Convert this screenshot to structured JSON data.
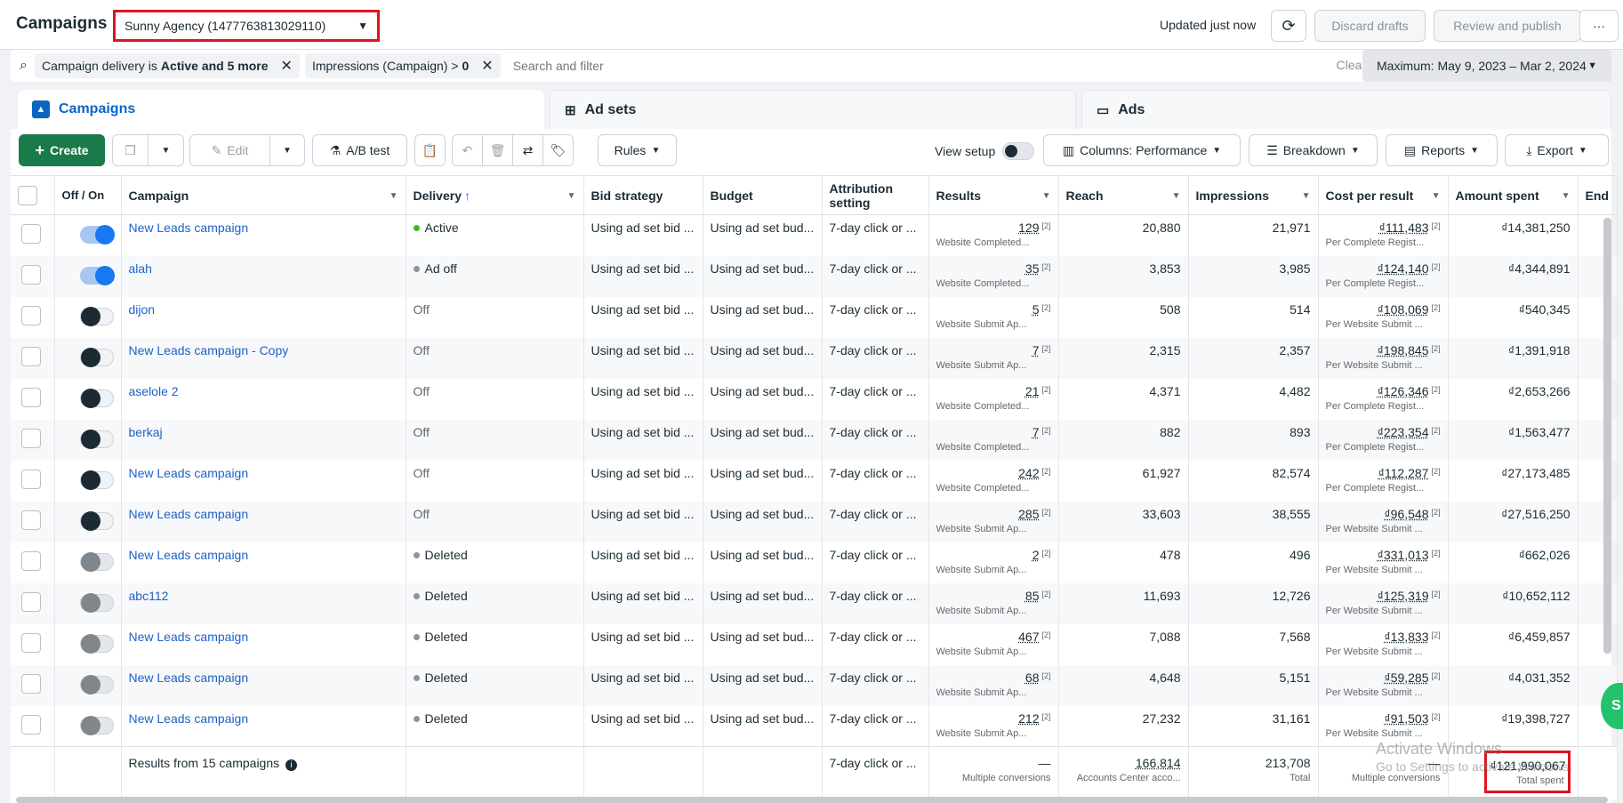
{
  "header": {
    "title": "Campaigns",
    "account_selector": "Sunny Agency (1477763813029110)",
    "updated": "Updated just now",
    "discard": "Discard drafts",
    "review": "Review and publish",
    "more": "···"
  },
  "filters": {
    "chip1_label": "Campaign delivery is",
    "chip1_value": "Active and 5 more",
    "chip2_label": "Impressions (Campaign) >",
    "chip2_value": "0",
    "search_placeholder": "Search and filter",
    "clear": "Clear",
    "date_range": "Maximum: May 9, 2023 – Mar 2, 2024"
  },
  "tabs": [
    "Campaigns",
    "Ad sets",
    "Ads"
  ],
  "toolbar": {
    "create": "Create",
    "edit": "Edit",
    "ab_test": "A/B test",
    "rules": "Rules",
    "view_setup": "View setup",
    "columns": "Columns: Performance",
    "breakdown": "Breakdown",
    "reports": "Reports",
    "export": "Export"
  },
  "columns": [
    "Off / On",
    "Campaign",
    "Delivery",
    "Bid strategy",
    "Budget",
    "Attribution setting",
    "Results",
    "Reach",
    "Impressions",
    "Cost per result",
    "Amount spent",
    "End"
  ],
  "rows": [
    {
      "toggle": "on",
      "name": "New Leads campaign",
      "delivery": "Active",
      "delivery_color": "#42b72a",
      "bid": "Using ad set bid ...",
      "budget": "Using ad set bud...",
      "attribution": "7-day click or ...",
      "results": "129",
      "results_sub": "Website Completed...",
      "reach": "20,880",
      "impressions": "21,971",
      "cpr": "₫111,483",
      "cpr_sub": "Per Complete Regist...",
      "spent": "₫14,381,250"
    },
    {
      "toggle": "on",
      "name": "alah",
      "delivery": "Ad off",
      "delivery_color": "#8d949e",
      "bid": "Using ad set bid ...",
      "budget": "Using ad set bud...",
      "attribution": "7-day click or ...",
      "results": "35",
      "results_sub": "Website Completed...",
      "reach": "3,853",
      "impressions": "3,985",
      "cpr": "₫124,140",
      "cpr_sub": "Per Complete Regist...",
      "spent": "₫4,344,891"
    },
    {
      "toggle": "off",
      "name": "dijon",
      "delivery": "Off",
      "delivery_color": "",
      "bid": "Using ad set bid ...",
      "budget": "Using ad set bud...",
      "attribution": "7-day click or ...",
      "results": "5",
      "results_sub": "Website Submit Ap...",
      "reach": "508",
      "impressions": "514",
      "cpr": "₫108,069",
      "cpr_sub": "Per Website Submit ...",
      "spent": "₫540,345"
    },
    {
      "toggle": "off",
      "name": "New Leads campaign - Copy",
      "delivery": "Off",
      "delivery_color": "",
      "bid": "Using ad set bid ...",
      "budget": "Using ad set bud...",
      "attribution": "7-day click or ...",
      "results": "7",
      "results_sub": "Website Submit Ap...",
      "reach": "2,315",
      "impressions": "2,357",
      "cpr": "₫198,845",
      "cpr_sub": "Per Website Submit ...",
      "spent": "₫1,391,918"
    },
    {
      "toggle": "off",
      "name": "aselole 2",
      "delivery": "Off",
      "delivery_color": "",
      "bid": "Using ad set bid ...",
      "budget": "Using ad set bud...",
      "attribution": "7-day click or ...",
      "results": "21",
      "results_sub": "Website Completed...",
      "reach": "4,371",
      "impressions": "4,482",
      "cpr": "₫126,346",
      "cpr_sub": "Per Complete Regist...",
      "spent": "₫2,653,266"
    },
    {
      "toggle": "off",
      "name": "berkaj",
      "delivery": "Off",
      "delivery_color": "",
      "bid": "Using ad set bid ...",
      "budget": "Using ad set bud...",
      "attribution": "7-day click or ...",
      "results": "7",
      "results_sub": "Website Completed...",
      "reach": "882",
      "impressions": "893",
      "cpr": "₫223,354",
      "cpr_sub": "Per Complete Regist...",
      "spent": "₫1,563,477"
    },
    {
      "toggle": "off",
      "name": "New Leads campaign",
      "delivery": "Off",
      "delivery_color": "",
      "bid": "Using ad set bid ...",
      "budget": "Using ad set bud...",
      "attribution": "7-day click or ...",
      "results": "242",
      "results_sub": "Website Completed...",
      "reach": "61,927",
      "impressions": "82,574",
      "cpr": "₫112,287",
      "cpr_sub": "Per Complete Regist...",
      "spent": "₫27,173,485"
    },
    {
      "toggle": "off",
      "name": "New Leads campaign",
      "delivery": "Off",
      "delivery_color": "",
      "bid": "Using ad set bid ...",
      "budget": "Using ad set bud...",
      "attribution": "7-day click or ...",
      "results": "285",
      "results_sub": "Website Submit Ap...",
      "reach": "33,603",
      "impressions": "38,555",
      "cpr": "₫96,548",
      "cpr_sub": "Per Website Submit ...",
      "spent": "₫27,516,250"
    },
    {
      "toggle": "del",
      "name": "New Leads campaign",
      "delivery": "Deleted",
      "delivery_color": "#8d949e",
      "bid": "Using ad set bid ...",
      "budget": "Using ad set bud...",
      "attribution": "7-day click or ...",
      "results": "2",
      "results_sub": "Website Submit Ap...",
      "reach": "478",
      "impressions": "496",
      "cpr": "₫331,013",
      "cpr_sub": "Per Website Submit ...",
      "spent": "₫662,026"
    },
    {
      "toggle": "del",
      "name": "abc112",
      "delivery": "Deleted",
      "delivery_color": "#8d949e",
      "bid": "Using ad set bid ...",
      "budget": "Using ad set bud...",
      "attribution": "7-day click or ...",
      "results": "85",
      "results_sub": "Website Submit Ap...",
      "reach": "11,693",
      "impressions": "12,726",
      "cpr": "₫125,319",
      "cpr_sub": "Per Website Submit ...",
      "spent": "₫10,652,112"
    },
    {
      "toggle": "del",
      "name": "New Leads campaign",
      "delivery": "Deleted",
      "delivery_color": "#8d949e",
      "bid": "Using ad set bid ...",
      "budget": "Using ad set bud...",
      "attribution": "7-day click or ...",
      "results": "467",
      "results_sub": "Website Submit Ap...",
      "reach": "7,088",
      "impressions": "7,568",
      "cpr": "₫13,833",
      "cpr_sub": "Per Website Submit ...",
      "spent": "₫6,459,857"
    },
    {
      "toggle": "del",
      "name": "New Leads campaign",
      "delivery": "Deleted",
      "delivery_color": "#8d949e",
      "bid": "Using ad set bid ...",
      "budget": "Using ad set bud...",
      "attribution": "7-day click or ...",
      "results": "68",
      "results_sub": "Website Submit Ap...",
      "reach": "4,648",
      "impressions": "5,151",
      "cpr": "₫59,285",
      "cpr_sub": "Per Website Submit ...",
      "spent": "₫4,031,352"
    },
    {
      "toggle": "del",
      "name": "New Leads campaign",
      "delivery": "Deleted",
      "delivery_color": "#8d949e",
      "bid": "Using ad set bid ...",
      "budget": "Using ad set bud...",
      "attribution": "7-day click or ...",
      "results": "212",
      "results_sub": "Website Submit Ap...",
      "reach": "27,232",
      "impressions": "31,161",
      "cpr": "₫91,503",
      "cpr_sub": "Per Website Submit ...",
      "spent": "₫19,398,727"
    }
  ],
  "totals": {
    "label": "Results from 15 campaigns",
    "attribution": "7-day click or ...",
    "results": "—",
    "results_sub": "Multiple conversions",
    "reach": "166,814",
    "reach_sub": "Accounts Center acco...",
    "impressions": "213,708",
    "impressions_sub": "Total",
    "cpr": "—",
    "cpr_sub": "Multiple conversions",
    "spent": "₫121,990,067",
    "spent_sub": "Total spent"
  },
  "watermark": {
    "line1": "Activate Windows",
    "line2": "Go to Settings to activate Windows."
  },
  "float_button": "S"
}
